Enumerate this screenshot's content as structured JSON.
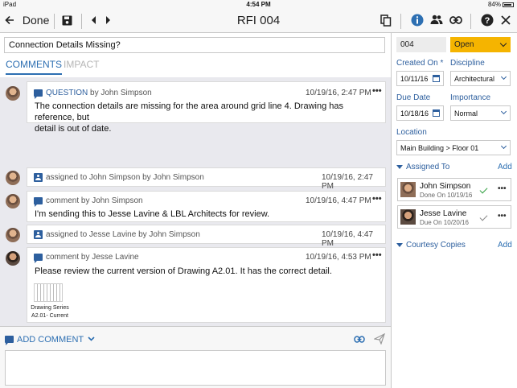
{
  "status_bar": {
    "device": "iPad",
    "time": "4:54 PM",
    "battery": "84%"
  },
  "toolbar": {
    "back_label": "Done",
    "title": "RFI 004"
  },
  "rfi": {
    "subject": "Connection Details Missing?"
  },
  "tabs": [
    {
      "label": "COMMENTS",
      "active": true
    },
    {
      "label": "IMPACT",
      "active": false
    }
  ],
  "question": {
    "kind": "QUESTION",
    "by": "by John Simpson",
    "date": "10/19/16, 2:47 PM",
    "text_line1": "The connection details are missing for the area around grid line 4. Drawing has reference, but",
    "text_line2": "detail is out of date."
  },
  "activity": [
    {
      "type": "assigned",
      "text": "assigned to John Simpson by John Simpson",
      "date": "10/19/16, 2:47 PM"
    },
    {
      "type": "comment",
      "text": "comment by John Simpson",
      "date": "10/19/16, 4:47 PM",
      "body": "I'm sending this to Jesse Lavine & LBL Architects for review."
    },
    {
      "type": "assigned",
      "text": "assigned to Jesse Lavine by John Simpson",
      "date": "10/19/16, 4:47 PM"
    },
    {
      "type": "comment",
      "text": "comment by Jesse Lavine",
      "date": "10/19/16, 4:53 PM",
      "body": "Please review the current version of Drawing A2.01. It has the correct detail.",
      "attachment_line1": "Drawing Series",
      "attachment_line2": "A2.01- Current"
    }
  ],
  "composer": {
    "label": "ADD COMMENT"
  },
  "details": {
    "number": "004",
    "status": "Open",
    "created_on_label": "Created On *",
    "created_on": "10/11/16",
    "discipline_label": "Discipline",
    "discipline": "Architectural",
    "due_date_label": "Due Date",
    "due_date": "10/18/16",
    "importance_label": "Importance",
    "importance": "Normal",
    "location_label": "Location",
    "location": "Main Building > Floor 01",
    "assigned_to_label": "Assigned To",
    "add_label": "Add",
    "assignees": [
      {
        "name": "John Simpson",
        "status": "Done On 10/19/16",
        "check_color": "#2e9e3e"
      },
      {
        "name": "Jesse Lavine",
        "status": "Due On 10/20/16",
        "check_color": "#888888"
      }
    ],
    "courtesy_label": "Courtesy Copies",
    "courtesy_add": "Add"
  },
  "colors": {
    "accent": "#2d6fb2",
    "status_open": "#f5b400"
  }
}
